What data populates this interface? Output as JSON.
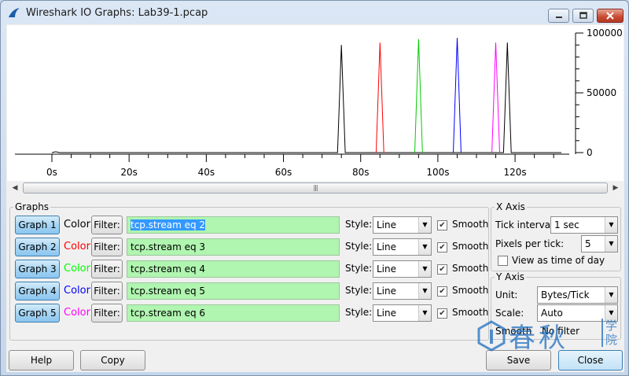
{
  "window": {
    "title": "Wireshark IO Graphs: Lab39-1.pcap"
  },
  "chart_data": {
    "type": "line",
    "x_tick_labels": [
      "0s",
      "20s",
      "40s",
      "60s",
      "80s",
      "100s",
      "120s"
    ],
    "y_tick_labels": [
      "100000",
      "50000",
      "0"
    ],
    "xlim": [
      0,
      132
    ],
    "ylim": [
      0,
      100000
    ],
    "series": [
      {
        "color": "#000000",
        "x": [
          0,
          1,
          2,
          74,
          75,
          76,
          117,
          118,
          119,
          132
        ],
        "y": [
          0,
          700,
          0,
          0,
          90000,
          0,
          0,
          92000,
          0,
          0
        ]
      },
      {
        "color": "#ff0000",
        "x": [
          84,
          85,
          86
        ],
        "y": [
          0,
          92000,
          0
        ]
      },
      {
        "color": "#00cc00",
        "x": [
          94,
          95,
          96
        ],
        "y": [
          0,
          95000,
          0
        ]
      },
      {
        "color": "#0000ff",
        "x": [
          104,
          105,
          106
        ],
        "y": [
          0,
          96000,
          0
        ]
      },
      {
        "color": "#ff00ff",
        "x": [
          114,
          115,
          116
        ],
        "y": [
          0,
          92000,
          0
        ]
      }
    ]
  },
  "graphs": {
    "legend": "Graphs",
    "color_label": "Color",
    "filter_label": "Filter:",
    "style_label": "Style:",
    "smooth_label": "Smooth",
    "items": [
      {
        "button": "Graph 1",
        "color": "#000000",
        "filter": "tcp.stream eq 2",
        "style": "Line",
        "smooth": true
      },
      {
        "button": "Graph 2",
        "color": "#ff0000",
        "filter": "tcp.stream eq 3",
        "style": "Line",
        "smooth": true
      },
      {
        "button": "Graph 3",
        "color": "#00ff00",
        "filter": "tcp.stream eq 4",
        "style": "Line",
        "smooth": true
      },
      {
        "button": "Graph 4",
        "color": "#0000ff",
        "filter": "tcp.stream eq 5",
        "style": "Line",
        "smooth": true
      },
      {
        "button": "Graph 5",
        "color": "#ff00ff",
        "filter": "tcp.stream eq 6",
        "style": "Line",
        "smooth": true
      }
    ]
  },
  "x_axis": {
    "legend": "X Axis",
    "tick_interval_label": "Tick interval:",
    "tick_interval_value": "1 sec",
    "pixels_per_tick_label": "Pixels per tick:",
    "pixels_per_tick_value": "5",
    "view_time_label": "View as time of day",
    "view_time_checked": false
  },
  "y_axis": {
    "legend": "Y Axis",
    "unit_label": "Unit:",
    "unit_value": "Bytes/Tick",
    "scale_label": "Scale:",
    "scale_value": "Auto",
    "smooth_label": "Smooth",
    "smooth_value": "No filter"
  },
  "footer": {
    "help": "Help",
    "copy": "Copy",
    "save": "Save",
    "close": "Close"
  },
  "watermark": {
    "text": "春秋",
    "side": "学院"
  }
}
